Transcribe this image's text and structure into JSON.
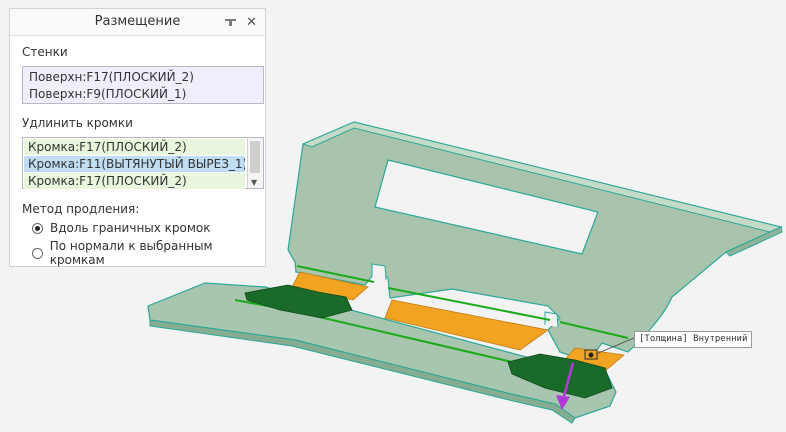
{
  "panel": {
    "title": "Размещение",
    "walls_label": "Стенки",
    "walls": [
      "Поверхн:F17(ПЛОСКИЙ_2)",
      "Поверхн:F9(ПЛОСКИЙ_1)"
    ],
    "extend_label": "Удлинить кромки",
    "edges": [
      "Кромка:F17(ПЛОСКИЙ_2)",
      "Кромка:F11(ВЫТЯНУТЫЙ ВЫРЕЗ_1)",
      "Кромка:F17(ПЛОСКИЙ_2)"
    ],
    "selected_edge_index": 1,
    "method_label": "Метод продления:",
    "method_options": [
      "Вдоль граничных кромок",
      "По нормали к выбранным кромкам"
    ],
    "selected_method_index": 0
  },
  "viewport": {
    "annotation": "[Толщина] Внутренний"
  },
  "colors": {
    "part_face": "#a7c5af",
    "part_edge": "#2aa898",
    "highlight_edge": "#1aaa1a",
    "orange_wall": "#f2a321",
    "dark_green_tab": "#1a6a2a",
    "arrow": "#b03bd8"
  }
}
